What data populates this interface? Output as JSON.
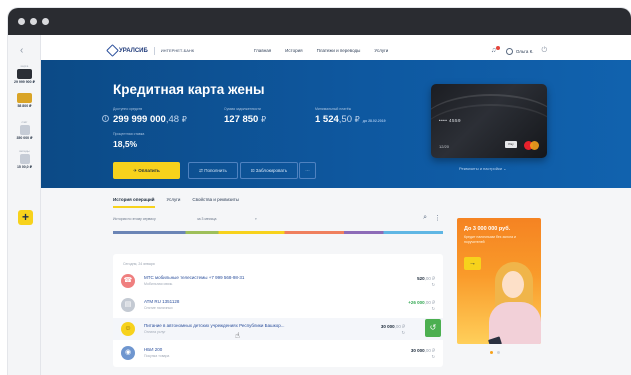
{
  "rail": {
    "cards": [
      {
        "caption": "карта",
        "amount": "29 999 900 ₽",
        "color": "#2b2f36"
      },
      {
        "caption": "",
        "amount": "58 800 ₽",
        "color": "#d9a427"
      },
      {
        "caption": "счёт",
        "amount": "350 000 ₽",
        "color": "#c6ccd6"
      },
      {
        "caption": "вклады",
        "amount": "15 00,0 ₽",
        "color": "#c6ccd6"
      }
    ],
    "add_label": "+"
  },
  "topbar": {
    "logo_text": "УРАЛСИБ",
    "logo_sub": "ИНТЕРНЕТ-БАНК",
    "nav": [
      "Главная",
      "История",
      "Платежи и переводы",
      "Услуги"
    ],
    "user_name": "Ольга К."
  },
  "hero": {
    "title": "Кредитная карта жены",
    "available_caption": "Доступно средств",
    "available_int": "299 999 000",
    "available_frac": ",48",
    "total_caption": "Сумма задолженности",
    "total_int": "127 850",
    "monthly_caption": "Минимальный платёж",
    "monthly_int": "1 524",
    "monthly_frac": ",50",
    "monthly_link": "до 28.02.2019",
    "rate_caption": "Процентная ставка",
    "rate_value": "18,5%",
    "currency": "₽",
    "pay_button": "Оплатить",
    "button_2": "Пополнить",
    "button_3": "Заблокировать",
    "button_more": "···",
    "card_number": "•••• 4559",
    "card_expiry": "12/20",
    "card_pay": "Pay",
    "card_caption": "Реквизиты и настройки ⌄"
  },
  "content": {
    "tabs": [
      "История операций",
      "Услуги",
      "Свойства и реквизиты"
    ],
    "search_placeholder": "История по этому сервису",
    "filter": "за 3 месяца",
    "filter2": "▾",
    "date_header": "Сегодня, 24 января"
  },
  "operations": [
    {
      "name": "МТС мобильные телесистемы +7 999 568-98-31",
      "category": "Мобильная связь",
      "amount": "520",
      "frac": ",00 ₽",
      "icon_color": "#ef7f7f",
      "positive": false,
      "action": false
    },
    {
      "name": "ATM RU 1351128",
      "category": "Снятие наличных",
      "amount": "+26 000",
      "frac": ",00 ₽",
      "icon_color": "#c4cad3",
      "positive": true,
      "action": false
    },
    {
      "name": "Питание в автономных детских учреждениях Республики Башкор...",
      "category": "Оплата услуг",
      "amount": "30 000",
      "frac": ",00 ₽",
      "icon_color": "#f7d21c",
      "positive": false,
      "action": true
    },
    {
      "name": "НБИ 200",
      "category": "Покупка товара",
      "amount": "30 000",
      "frac": ",00 ₽",
      "icon_color": "#6f96cf",
      "positive": false,
      "action": false
    }
  ],
  "promo": {
    "title": "До 3 000 000 руб.",
    "text": "Кредит наличными без залога и поручителей",
    "button": "→",
    "colors": {
      "top": "#f58322",
      "bottom": "#ffcf5a"
    }
  }
}
